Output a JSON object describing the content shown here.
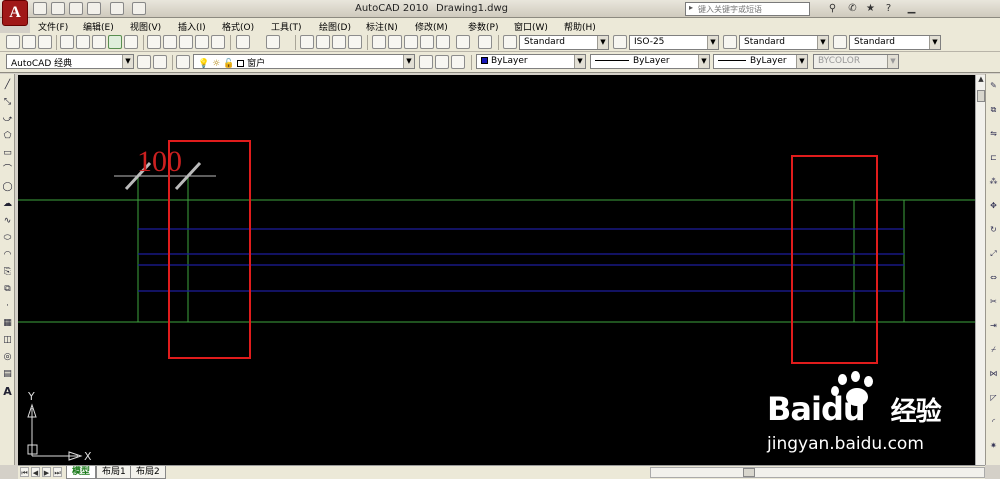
{
  "titlebar": {
    "logo": "A",
    "app_title": "AutoCAD 2010",
    "file_name": "Drawing1.dwg",
    "search_placeholder": "键入关键字或短语"
  },
  "menu": {
    "items": [
      "文件(F)",
      "编辑(E)",
      "视图(V)",
      "插入(I)",
      "格式(O)",
      "工具(T)",
      "绘图(D)",
      "标注(N)",
      "修改(M)",
      "参数(P)",
      "窗口(W)",
      "帮助(H)"
    ]
  },
  "styles": {
    "text_style": "Standard",
    "dim_style": "ISO-25",
    "table_style": "Standard",
    "multileader_style": "Standard"
  },
  "workspace": {
    "name": "AutoCAD 经典",
    "layer": "窗户",
    "color": "ByLayer",
    "linetype": "ByLayer",
    "lineweight": "ByLayer",
    "plotstyle": "BYCOLOR"
  },
  "drawing": {
    "dimension_text": "100",
    "colors": {
      "canvas": "#000000",
      "wall_lines": "#3ea33e",
      "window_lines": "#1c1c9c",
      "highlight": "#e01c1c",
      "dimension": "#cc2020"
    }
  },
  "ucs": {
    "x_label": "X",
    "y_label": "Y"
  },
  "layout_tabs": [
    "模型",
    "布局1",
    "布局2"
  ],
  "active_layout": "模型",
  "watermark": {
    "brand": "Baidu",
    "brand_cn": "经验",
    "url": "jingyan.baidu.com"
  }
}
